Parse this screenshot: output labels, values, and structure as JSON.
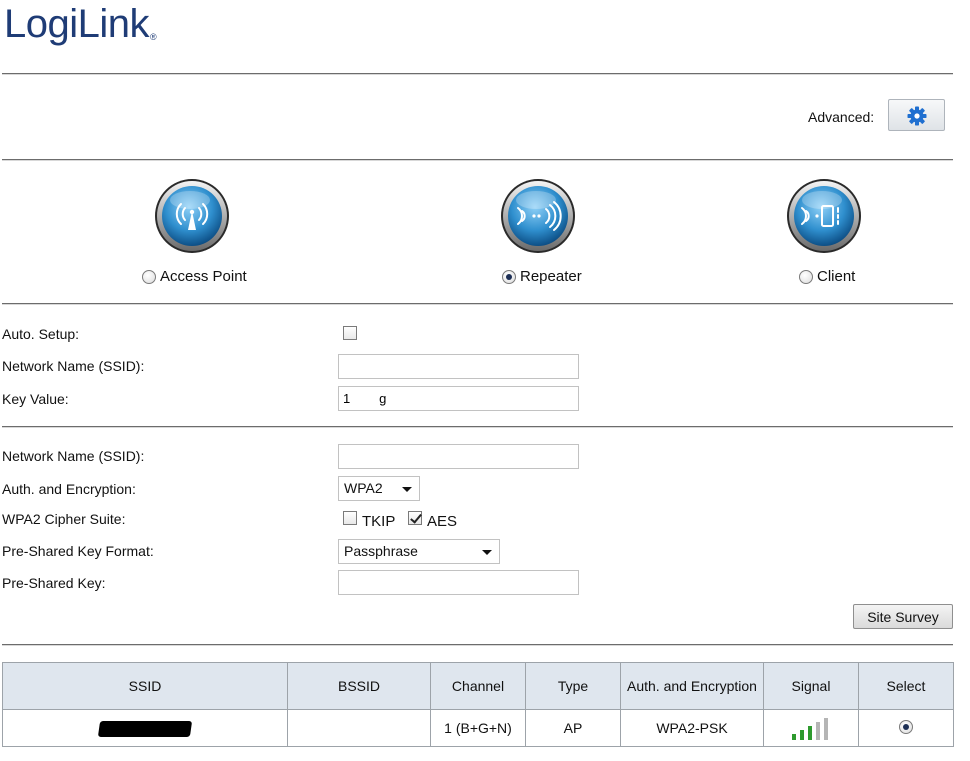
{
  "brand": {
    "logo_text": "LogiLink",
    "logo_mark": "®"
  },
  "colors": {
    "brand": "#1f3c76",
    "accent": "#1f6fd0",
    "table_header": "#dfe6ee",
    "signal_on": "#2e9a2e",
    "signal_off": "#b5b5b5"
  },
  "advanced": {
    "label": "Advanced:",
    "icon": "gear-icon"
  },
  "modes": [
    {
      "label": "Access Point",
      "icon": "access-point-icon",
      "checked": false
    },
    {
      "label": "Repeater",
      "icon": "repeater-icon",
      "checked": true
    },
    {
      "label": "Client",
      "icon": "client-icon",
      "checked": false
    }
  ],
  "repeater_section": {
    "auto_setup_label": "Auto. Setup:",
    "auto_setup_checked": false,
    "ssid_label": "Network Name (SSID):",
    "ssid_value": "",
    "key_label": "Key Value:",
    "key_value": "1        g"
  },
  "security_section": {
    "ssid_label": "Network Name (SSID):",
    "ssid_value": "",
    "auth_label": "Auth. and Encryption:",
    "auth_value": "WPA2",
    "cipher_label": "WPA2 Cipher Suite:",
    "tkip_label": "TKIP",
    "tkip_checked": false,
    "aes_label": "AES",
    "aes_checked": true,
    "psk_format_label": "Pre-Shared Key Format:",
    "psk_format_value": "Passphrase",
    "psk_label": "Pre-Shared Key:",
    "psk_value": ""
  },
  "site_survey": {
    "button_label": "Site Survey"
  },
  "survey_table": {
    "headers": [
      "SSID",
      "BSSID",
      "Channel",
      "Type",
      "Auth. and Encryption",
      "Signal",
      "Select"
    ],
    "rows": [
      {
        "ssid": "",
        "bssid": "",
        "channel": "1 (B+G+N)",
        "type": "AP",
        "auth": "WPA2-PSK",
        "signal_bars": 3,
        "signal_max": 5,
        "selected": true
      }
    ]
  }
}
